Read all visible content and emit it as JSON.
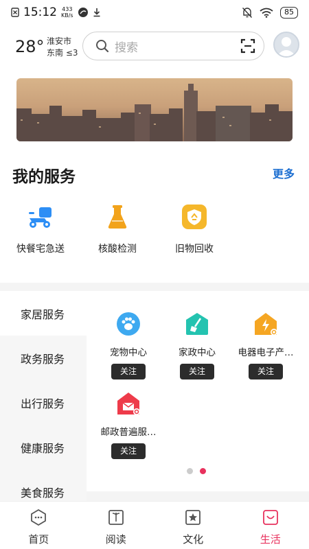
{
  "status_bar": {
    "time": "15:12",
    "net_speed_value": "433",
    "net_speed_unit": "KB/s",
    "battery": "85"
  },
  "header": {
    "temperature": "28°",
    "city": "淮安市",
    "wind": "东南 ≤3",
    "search_placeholder": "搜索"
  },
  "my_services": {
    "title": "我的服务",
    "more": "更多",
    "items": [
      {
        "label": "快餐宅急送",
        "icon": "delivery-scooter-icon",
        "color": "#2d8ef5"
      },
      {
        "label": "核酸检测",
        "icon": "test-flask-icon",
        "color": "#f2a31b"
      },
      {
        "label": "旧物回收",
        "icon": "recycle-badge-icon",
        "color": "#f5b72b"
      }
    ]
  },
  "categories": [
    {
      "label": "家居服务",
      "active": true
    },
    {
      "label": "政务服务",
      "active": false
    },
    {
      "label": "出行服务",
      "active": false
    },
    {
      "label": "健康服务",
      "active": false
    },
    {
      "label": "美食服务",
      "active": false
    }
  ],
  "category_tiles": [
    {
      "name": "宠物中心",
      "follow": "关注",
      "icon": "pet-paw-icon"
    },
    {
      "name": "家政中心",
      "follow": "关注",
      "icon": "cleaning-broom-icon"
    },
    {
      "name": "电器电子产…",
      "follow": "关注",
      "icon": "appliance-house-icon"
    },
    {
      "name": "邮政普遍服…",
      "follow": "关注",
      "icon": "postal-mail-icon"
    }
  ],
  "pagination": {
    "current": 2,
    "total": 2
  },
  "tabbar": [
    {
      "label": "首页",
      "active": false
    },
    {
      "label": "阅读",
      "active": false
    },
    {
      "label": "文化",
      "active": false
    },
    {
      "label": "生活",
      "active": true
    }
  ],
  "colors": {
    "accent": "#e8315d",
    "link": "#1d6fd1",
    "follow_button": "#2c2c2c"
  }
}
